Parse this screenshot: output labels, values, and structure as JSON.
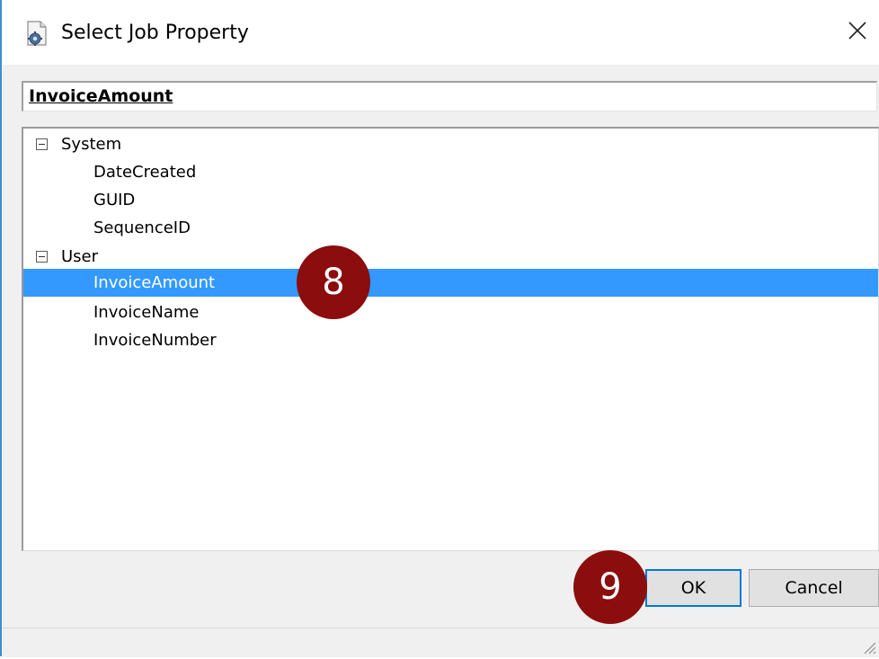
{
  "window": {
    "title": "Select Job Property",
    "title_icon": "document-gear-icon",
    "close_icon": "close-icon",
    "accent_color": "#3c8fd3"
  },
  "property_field": {
    "value": "InvoiceAmount"
  },
  "tree": {
    "selection_color": "#3399ff",
    "groups": [
      {
        "label": "System",
        "expanded": true,
        "items": [
          "DateCreated",
          "GUID",
          "SequenceID"
        ]
      },
      {
        "label": "User",
        "expanded": true,
        "items": [
          "InvoiceAmount",
          "InvoiceName",
          "InvoiceNumber"
        ]
      }
    ],
    "selected_item": "InvoiceAmount"
  },
  "callouts": {
    "color": "#8b0d0d",
    "tree_selection": "8",
    "ok_button": "9"
  },
  "buttons": {
    "ok_label": "OK",
    "cancel_label": "Cancel"
  }
}
